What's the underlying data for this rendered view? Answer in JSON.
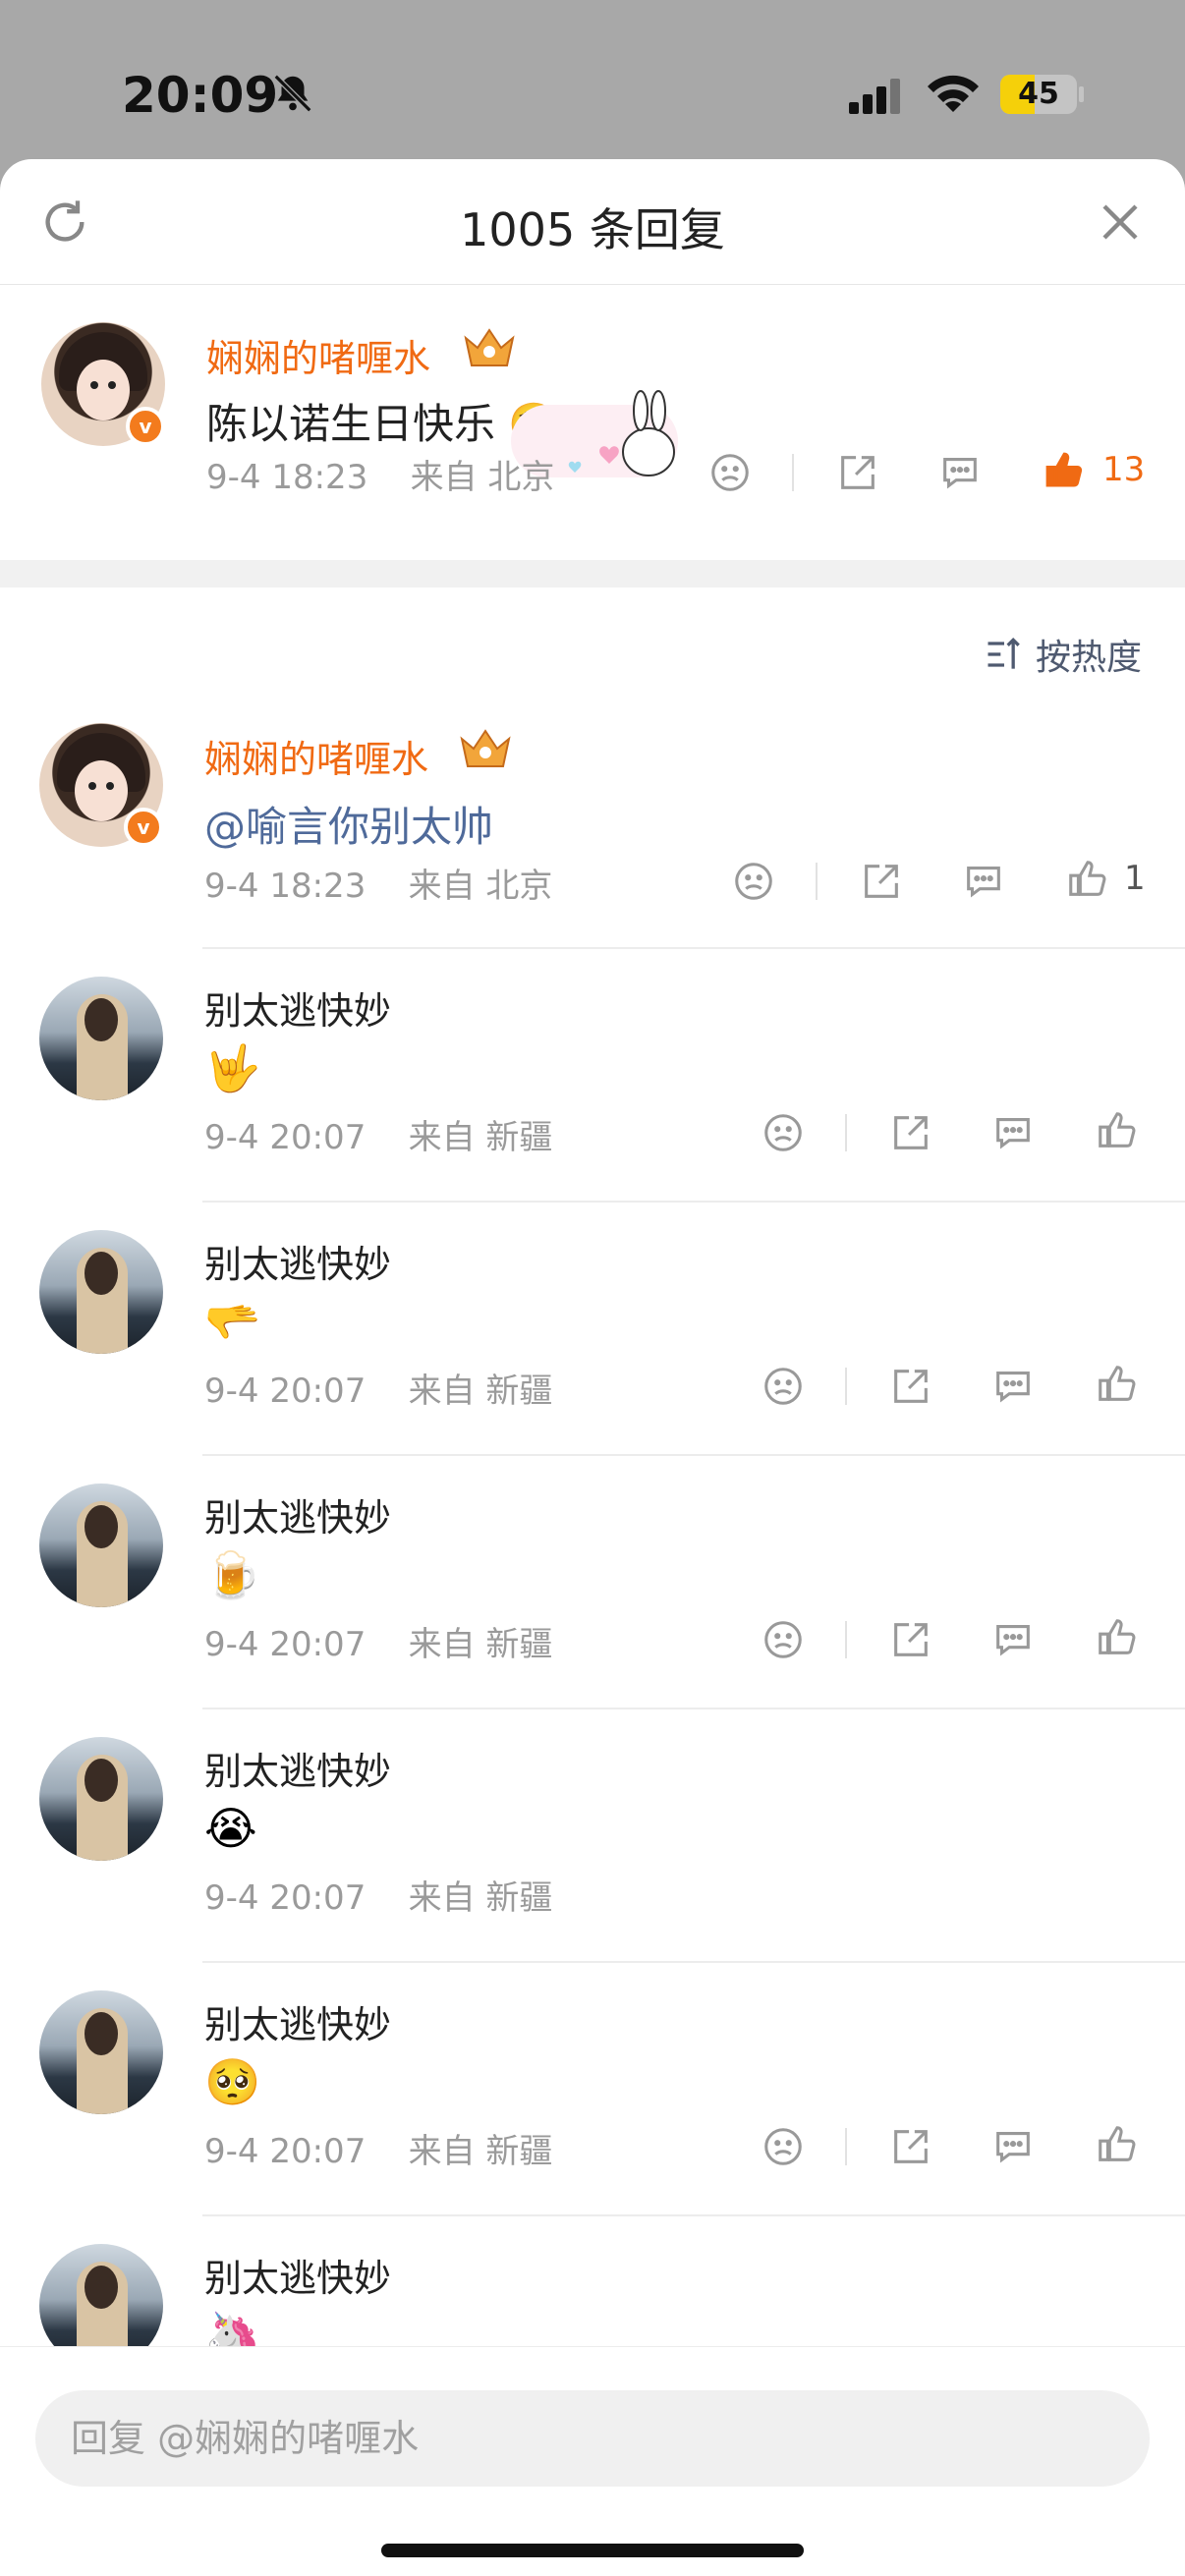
{
  "status_bar": {
    "time": "20:09",
    "battery": "45",
    "battery_level": 0.45,
    "icons": [
      "bell-slash-icon",
      "signal-icon",
      "wifi-icon",
      "battery-icon"
    ]
  },
  "header": {
    "title": "1005 条回复",
    "icons": [
      "refresh-icon",
      "close-icon"
    ]
  },
  "root_comment": {
    "username": "娴娴的啫喱水",
    "text": "陈以诺生日快乐",
    "emoji": "🥺",
    "time": "9-4 18:23",
    "source": "来自 北京",
    "like_count": "13"
  },
  "sort": {
    "label": "按热度"
  },
  "replies": [
    {
      "username": "娴娴的啫喱水",
      "mention": "@喻言你别太帅",
      "time": "9-4 18:23",
      "source": "来自 北京",
      "like_count": "1"
    },
    {
      "username": "别太逃快妙",
      "emoji": "🤟",
      "time": "9-4 20:07",
      "source": "来自 新疆",
      "like_count": ""
    },
    {
      "username": "别太逃快妙",
      "emoji": "🫳",
      "time": "9-4 20:07",
      "source": "来自 新疆",
      "like_count": ""
    },
    {
      "username": "别太逃快妙",
      "emoji": "🍺",
      "time": "9-4 20:07",
      "source": "来自 新疆",
      "like_count": ""
    },
    {
      "username": "别太逃快妙",
      "emoji": "😭",
      "time": "9-4 20:07",
      "source": "来自 新疆",
      "like_count": ""
    },
    {
      "username": "别太逃快妙",
      "emoji": "🥺",
      "time": "9-4 20:07",
      "source": "来自 新疆",
      "like_count": ""
    },
    {
      "username": "别太逃快妙",
      "emoji": "🦄",
      "time": "",
      "source": "",
      "like_count": ""
    }
  ],
  "reply_input": {
    "placeholder": "回复 @娴娴的啫喱水"
  },
  "colors": {
    "accent": "#f06a13",
    "mention": "#4f6a9a",
    "meta": "#9a9a9a"
  }
}
